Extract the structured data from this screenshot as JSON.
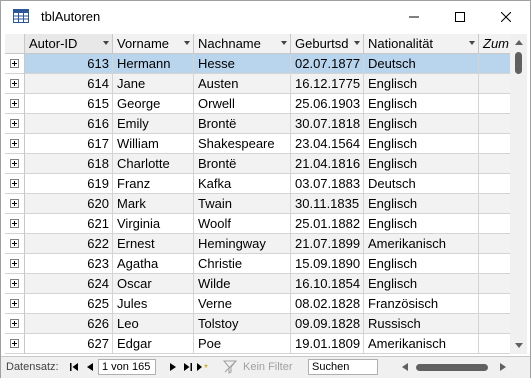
{
  "window": {
    "title": "tblAutoren",
    "icon": "table-icon"
  },
  "columns": [
    {
      "label": "Autor-ID",
      "key": "id",
      "italic": false
    },
    {
      "label": "Vorname",
      "key": "vorname",
      "italic": false
    },
    {
      "label": "Nachname",
      "key": "nachname",
      "italic": false
    },
    {
      "label": "Geburtsd",
      "key": "geburt",
      "italic": false
    },
    {
      "label": "Nationalität",
      "key": "nation",
      "italic": false
    },
    {
      "label": "Zum",
      "key": "extra",
      "italic": true
    }
  ],
  "rows": [
    {
      "id": "613",
      "vorname": "Hermann",
      "nachname": "Hesse",
      "geburt": "02.07.1877",
      "nation": "Deutsch"
    },
    {
      "id": "614",
      "vorname": "Jane",
      "nachname": "Austen",
      "geburt": "16.12.1775",
      "nation": "Englisch"
    },
    {
      "id": "615",
      "vorname": "George",
      "nachname": "Orwell",
      "geburt": "25.06.1903",
      "nation": "Englisch"
    },
    {
      "id": "616",
      "vorname": "Emily",
      "nachname": "Brontë",
      "geburt": "30.07.1818",
      "nation": "Englisch"
    },
    {
      "id": "617",
      "vorname": "William",
      "nachname": "Shakespeare",
      "geburt": "23.04.1564",
      "nation": "Englisch"
    },
    {
      "id": "618",
      "vorname": "Charlotte",
      "nachname": "Brontë",
      "geburt": "21.04.1816",
      "nation": "Englisch"
    },
    {
      "id": "619",
      "vorname": "Franz",
      "nachname": "Kafka",
      "geburt": "03.07.1883",
      "nation": "Deutsch"
    },
    {
      "id": "620",
      "vorname": "Mark",
      "nachname": "Twain",
      "geburt": "30.11.1835",
      "nation": "Englisch"
    },
    {
      "id": "621",
      "vorname": "Virginia",
      "nachname": "Woolf",
      "geburt": "25.01.1882",
      "nation": "Englisch"
    },
    {
      "id": "622",
      "vorname": "Ernest",
      "nachname": "Hemingway",
      "geburt": "21.07.1899",
      "nation": "Amerikanisch"
    },
    {
      "id": "623",
      "vorname": "Agatha",
      "nachname": "Christie",
      "geburt": "15.09.1890",
      "nation": "Englisch"
    },
    {
      "id": "624",
      "vorname": "Oscar",
      "nachname": "Wilde",
      "geburt": "16.10.1854",
      "nation": "Englisch"
    },
    {
      "id": "625",
      "vorname": "Jules",
      "nachname": "Verne",
      "geburt": "08.02.1828",
      "nation": "Französisch"
    },
    {
      "id": "626",
      "vorname": "Leo",
      "nachname": "Tolstoy",
      "geburt": "09.09.1828",
      "nation": "Russisch"
    },
    {
      "id": "627",
      "vorname": "Edgar",
      "nachname": "Poe",
      "geburt": "19.01.1809",
      "nation": "Amerikanisch"
    }
  ],
  "active_row": 0,
  "navigation": {
    "label": "Datensatz:",
    "position": "1 von 165",
    "filter_label": "Kein Filter",
    "search_placeholder": "Suchen"
  },
  "colors": {
    "selected_row": "#b9d5ee",
    "alt_row": "#f2f2f2",
    "header": "#f2f2f2"
  }
}
